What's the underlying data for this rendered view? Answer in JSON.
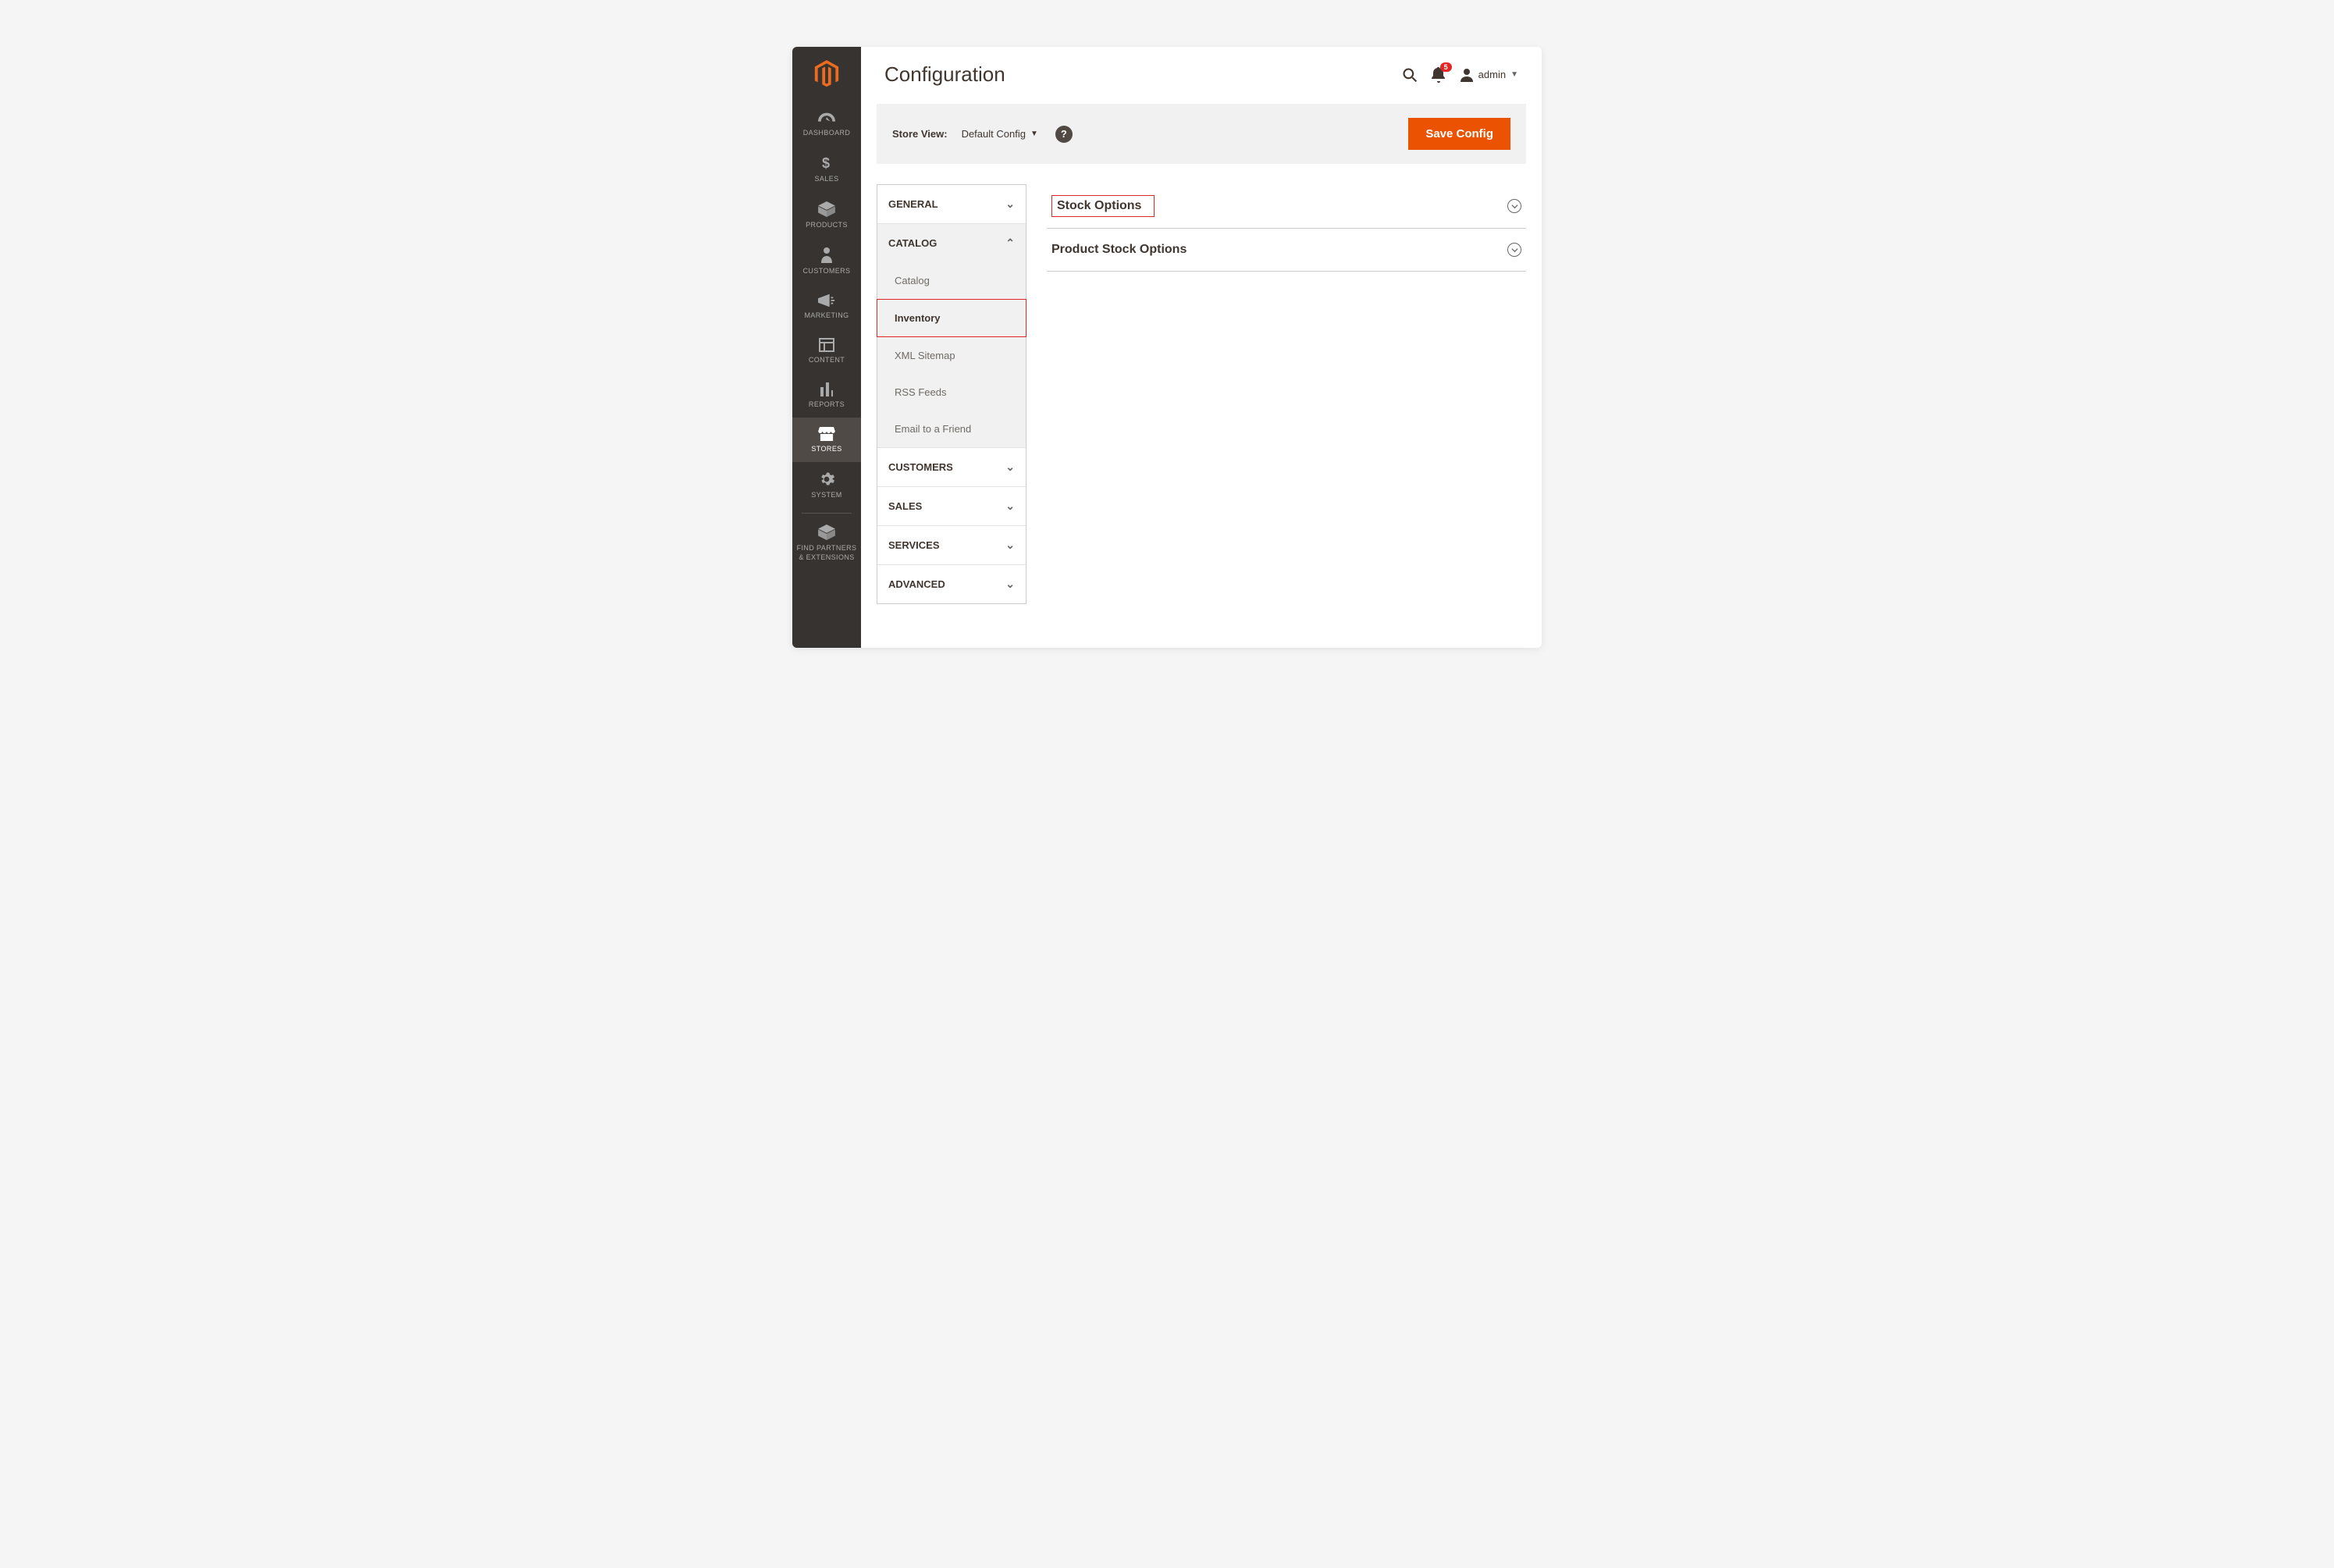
{
  "page_title": "Configuration",
  "header": {
    "notification_count": "5",
    "admin_label": "admin"
  },
  "scope": {
    "label": "Store View:",
    "value": "Default Config",
    "save_button": "Save Config"
  },
  "sidebar": {
    "dashboard": "DASHBOARD",
    "sales": "SALES",
    "products": "PRODUCTS",
    "customers": "CUSTOMERS",
    "marketing": "MARKETING",
    "content": "CONTENT",
    "reports": "REPORTS",
    "stores": "STORES",
    "system": "SYSTEM",
    "partners_line1": "FIND PARTNERS",
    "partners_line2": "& EXTENSIONS"
  },
  "config_tabs": {
    "general": "GENERAL",
    "catalog": "CATALOG",
    "catalog_items": {
      "catalog": "Catalog",
      "inventory": "Inventory",
      "xml_sitemap": "XML Sitemap",
      "rss_feeds": "RSS Feeds",
      "email_friend": "Email to a Friend"
    },
    "customers": "CUSTOMERS",
    "sales": "SALES",
    "services": "SERVICES",
    "advanced": "ADVANCED"
  },
  "sections": {
    "stock_options": "Stock Options",
    "product_stock_options": "Product Stock Options"
  }
}
